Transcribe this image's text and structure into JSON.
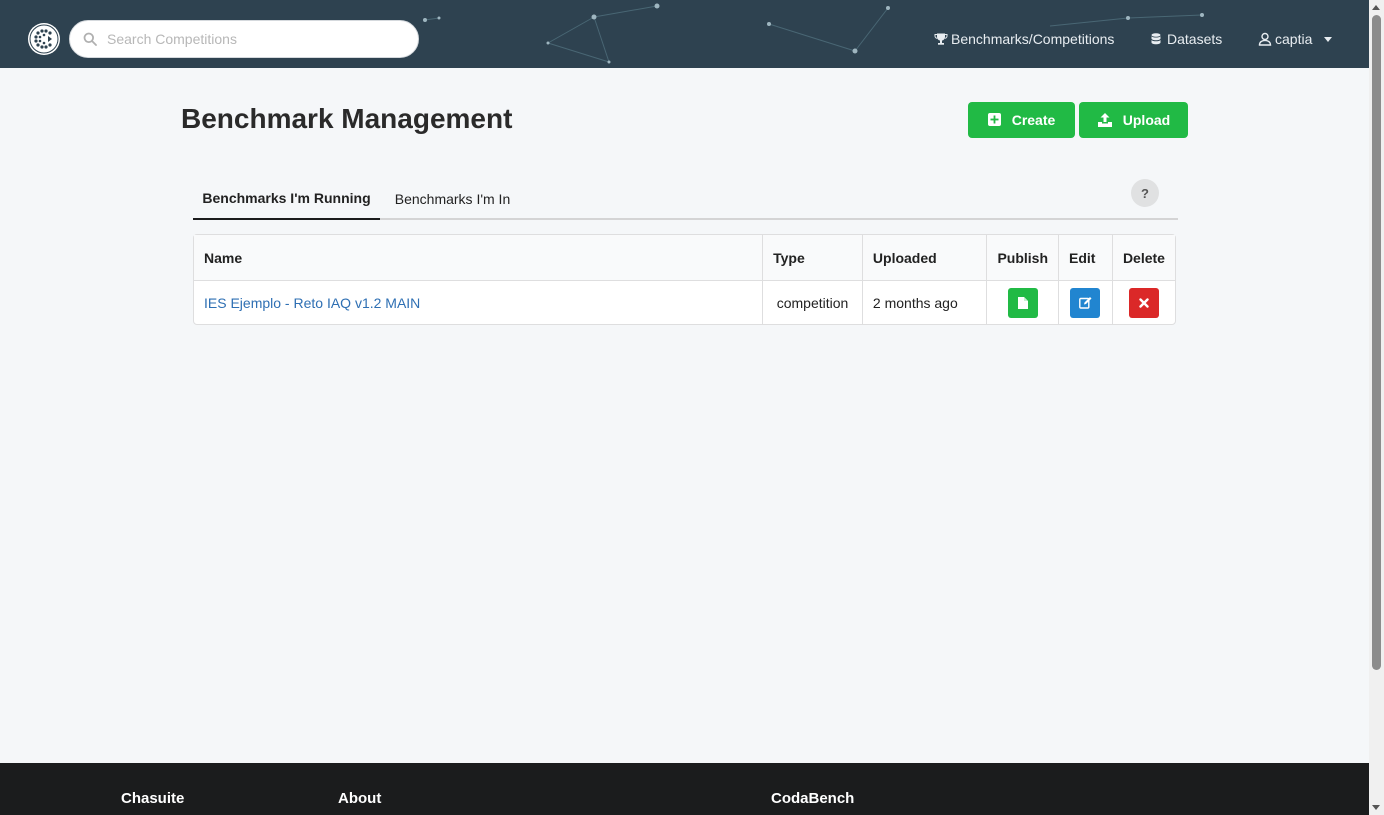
{
  "header": {
    "search_placeholder": "Search Competitions",
    "nav": {
      "benchmarks": "Benchmarks/Competitions",
      "datasets": "Datasets",
      "user": "captia"
    }
  },
  "main": {
    "title": "Benchmark Management",
    "buttons": {
      "create": "Create",
      "upload": "Upload"
    },
    "tabs": [
      {
        "label": "Benchmarks I'm Running",
        "active": true
      },
      {
        "label": "Benchmarks I'm In",
        "active": false
      }
    ],
    "help_label": "?",
    "table": {
      "columns": [
        "Name",
        "Type",
        "Uploaded",
        "Publish",
        "Edit",
        "Delete"
      ],
      "rows": [
        {
          "name": "IES Ejemplo - Reto IAQ v1.2 MAIN",
          "type": "competition",
          "uploaded": "2 months ago"
        }
      ]
    }
  },
  "footer": {
    "headings": [
      "Chasuite",
      "About",
      "CodaBench"
    ]
  },
  "colors": {
    "navbar": "#2e4250",
    "primary_green": "#21ba45",
    "edit_blue": "#2185d0",
    "delete_red": "#db2828",
    "link": "#2e6fb3",
    "footer": "#1b1c1d"
  },
  "icons": {
    "logo": "codabench-logo",
    "search": "search-icon",
    "benchmarks": "trophy-icon",
    "datasets": "database-icon",
    "user": "user-icon",
    "create": "plus-square-icon",
    "upload": "upload-icon",
    "publish": "file-icon",
    "edit": "edit-icon",
    "delete": "close-icon"
  }
}
